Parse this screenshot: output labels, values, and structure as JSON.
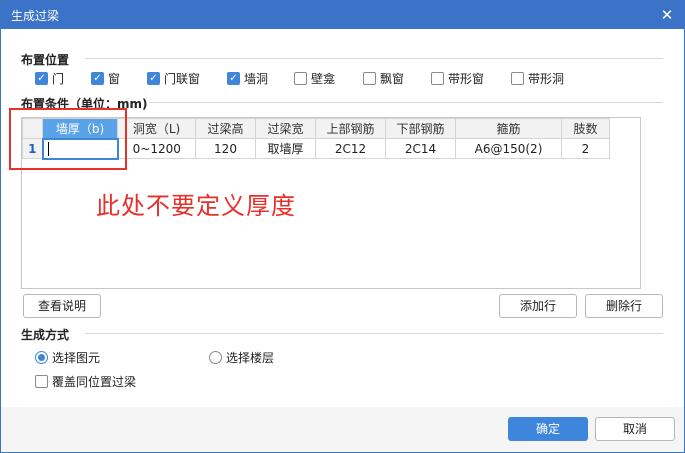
{
  "window": {
    "title": "生成过梁",
    "close_glyph": "✕"
  },
  "placement": {
    "title": "布置位置",
    "options": [
      {
        "label": "门",
        "checked": true
      },
      {
        "label": "窗",
        "checked": true
      },
      {
        "label": "门联窗",
        "checked": true
      },
      {
        "label": "墙洞",
        "checked": true
      },
      {
        "label": "壁龛",
        "checked": false
      },
      {
        "label": "飘窗",
        "checked": false
      },
      {
        "label": "带形窗",
        "checked": false
      },
      {
        "label": "带形洞",
        "checked": false
      }
    ]
  },
  "conditions": {
    "title": "布置条件（单位：mm)",
    "columns": [
      "墙厚（b)",
      "洞宽（L)",
      "过梁高",
      "过梁宽",
      "上部钢筋",
      "下部钢筋",
      "箍筋",
      "肢数"
    ],
    "rows": [
      {
        "num": "1",
        "cells": [
          "",
          "0~1200",
          "120",
          "取墙厚",
          "2C12",
          "2C14",
          "A6@150(2)",
          "2"
        ]
      }
    ]
  },
  "annotation": {
    "text": "此处不要定义厚度",
    "color": "#e8302a"
  },
  "buttons": {
    "view_help": "查看说明",
    "add_row": "添加行",
    "delete_row": "删除行",
    "ok": "确定",
    "cancel": "取消"
  },
  "generation": {
    "title": "生成方式",
    "radio_select_element": "选择图元",
    "radio_select_floor": "选择楼层",
    "selected": "选择图元",
    "overwrite_label": "覆盖同位置过梁",
    "overwrite_checked": false
  },
  "colors": {
    "title_bar": "#3a73c7",
    "accent": "#3e86dc",
    "header_selected": "#5aa2e8"
  }
}
